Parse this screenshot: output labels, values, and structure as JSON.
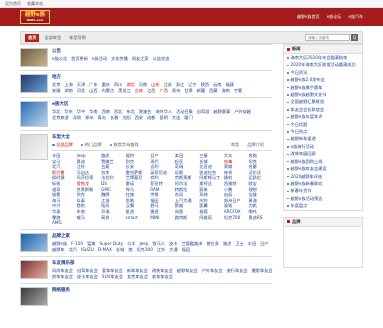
{
  "topbar": {
    "links": [
      "设为首页",
      "收藏本站"
    ]
  },
  "header": {
    "logo_main": "越野e族",
    "logo_sub": "fblife.com",
    "links": [
      "越野e族首页",
      "e族论坛",
      "e族汽车"
    ]
  },
  "nav": {
    "home": "首页",
    "crumbs": [
      "全部车型",
      "车型导购"
    ],
    "search_placeholder": "请输入关键词",
    "search_icon": "Q"
  },
  "sections": [
    {
      "title": "公告",
      "rows": [
        [
          "e族公告",
          "首页更新",
          "e族活动",
          "文化传播",
          "网友之家",
          "公益交流"
        ]
      ]
    },
    {
      "title": "地方",
      "rows": [
        [
          "北京",
          "上海",
          "天津",
          "广东",
          "重庆",
          "四川",
          "湖北",
          "河南",
          "山东",
          "江苏",
          "浙江",
          "辽宁",
          "陕西",
          "云南",
          "福建"
        ],
        [
          "安徽",
          "湖南",
          "河北",
          "山西",
          "内蒙古",
          "黑龙江",
          "吉林",
          "江西",
          "广西",
          "贵州",
          "甘肃",
          "新疆",
          "西藏",
          "海南",
          "宁夏"
        ]
      ]
    },
    {
      "title": "e族大区",
      "rows": [
        [
          "华北",
          "华东",
          "华中",
          "华南",
          "西南",
          "西北",
          "东北",
          "港澳台",
          "海外华人",
          "活动召集",
          "自驾游",
          "越野赛事",
          "户外穿越"
        ],
        [
          "北京旅游",
          "深圳",
          "郑州",
          "青岛",
          "长春",
          "沈阳",
          "西安",
          "成都",
          "昆明",
          "大连",
          "厦门"
        ]
      ]
    },
    {
      "title": "品牌之家",
      "rows": [
        [
          "越野e族",
          "F-150",
          "猛禽",
          "Super Duty",
          "公羊",
          "Jeep",
          "牧马人",
          "皮卡",
          "兰德酷路泽",
          "普拉多",
          "路虎",
          "卫士",
          "丰田",
          "日产"
        ],
        [
          "越野车",
          "北汽",
          "ISUZU",
          "D-MAX",
          "长城",
          "炮",
          "坦克300",
          "江铃",
          "大通",
          "福田"
        ]
      ]
    },
    {
      "title": "车友俱乐部",
      "rows": [
        [
          "风尚车友会",
          "自驾车友会",
          "爱车车友会",
          "新车车友会",
          "改装车友会",
          "越野车友会",
          "户外车友会",
          "旅行车友会",
          "摄影车友会"
        ],
        [
          "房车车友会",
          "皮卡车友会",
          "SUV车友会",
          "女性车友会",
          "老车车友会"
        ]
      ]
    },
    {
      "title": "网络服务",
      "rows": []
    }
  ],
  "brand": {
    "title": "车型大全",
    "tabs": [
      "全部品牌",
      "热门品牌",
      "按首字母查找"
    ],
    "brand_labels": [
      "车型",
      "品牌介绍"
    ],
    "items": [
      "丰田",
      "Jeep",
      "路虎",
      "福特",
      "日产",
      "本田",
      "三菱",
      "大众",
      "奔驰",
      "宝马",
      "奥迪",
      "雪佛兰",
      "别克",
      "现代",
      "起亚",
      "长城",
      "哈弗",
      "坦克",
      "北汽",
      "江铃",
      "五菱",
      "长安",
      "吉利",
      "奇瑞",
      "比亚迪",
      "荣威",
      "名爵",
      "斯巴鲁",
      "马自达",
      "铃木",
      "雷克萨斯",
      "英菲尼迪",
      "讴歌",
      "凯迪拉克",
      "林肯",
      "沃尔沃",
      "保时捷",
      "玛莎拉蒂",
      "法拉利",
      "兰博基尼",
      "宾利",
      "劳斯莱斯",
      "阿斯顿马丁",
      "捷豹",
      "迈凯伦",
      "标致",
      "雪铁龙",
      "DS",
      "雷诺",
      "菲亚特",
      "阿尔法",
      "斯柯达",
      "西雅特",
      "欧宝",
      "道奇",
      "克莱斯勒",
      "GMC",
      "悍马",
      "RAM",
      "特斯拉",
      "蔚来",
      "小鹏",
      "理想",
      "极氪",
      "领克",
      "魏牌",
      "红旗",
      "传祺",
      "东风",
      "风神",
      "启辰",
      "宝骏",
      "海马",
      "众泰",
      "江淮",
      "思皓",
      "福田",
      "上汽大通",
      "庆铃",
      "郑州日产",
      "黄海",
      "中兴",
      "猎豹",
      "陆风",
      "汉腾",
      "野马",
      "斯威",
      "凯翼",
      "观致",
      "力帆",
      "华泰",
      "东南",
      "开瑞",
      "星途",
      "捷途",
      "岚图",
      "极狐",
      "ARCFOX",
      "哪吒",
      "零跑",
      "威马",
      "高合",
      "smart",
      "MINI",
      "路特斯",
      "阿维塔",
      "坦克700",
      "奥迪RS",
      "AMG"
    ],
    "highlights": [
      16,
      27,
      46
    ]
  },
  "sidebar": {
    "news_title": "新闻",
    "news": [
      "海南大区2020年年会圆满结束",
      "2020年海南大区联谊活动圆满成功",
      "今日资讯",
      "越野e族2.0发布会",
      "越野e族携手赛车",
      "越野e族越野文化节",
      "全国越野汇聚联谊",
      "车友会会长联谊会",
      "越野e族年度车评",
      "今日话题",
      "今日热点",
      "越野新车速递",
      "e族骑行活动",
      "改装车展回顾",
      "越野e族团购上线",
      "越野e族车友会建设",
      "2020越野车评选",
      "越野e族新春联欢",
      "新春年货节",
      "越野e族活动预告",
      "年度盘点"
    ],
    "box2_title": "品牌"
  }
}
